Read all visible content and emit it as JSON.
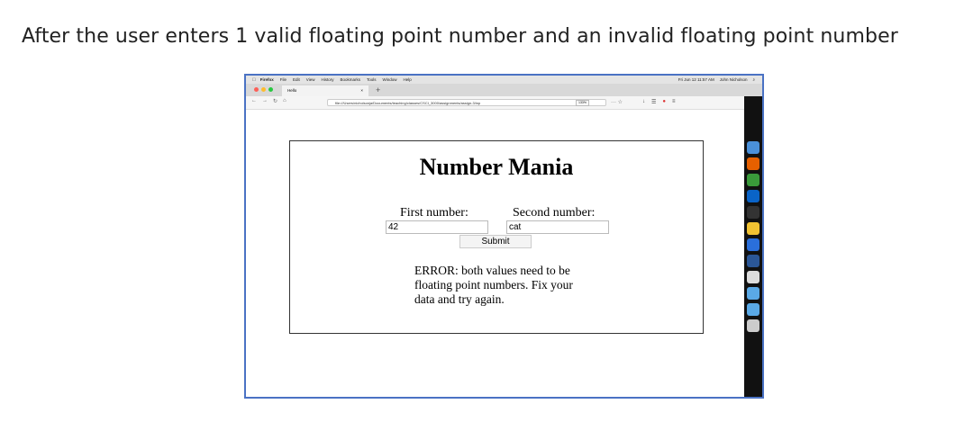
{
  "caption": "After the user enters 1 valid floating point number and an invalid floating point number",
  "menubar": {
    "app": "Firefox",
    "items": [
      "File",
      "Edit",
      "View",
      "History",
      "Bookmarks",
      "Tools",
      "Window",
      "Help"
    ],
    "clock": "Fri Jun 12  11:57 AM",
    "user": "John Nicholson"
  },
  "tab": {
    "title": "Hello",
    "close": "×",
    "new_tab": "+"
  },
  "url": {
    "value": "file:///Users/nicholsonja/Documents/teaching/classes/CSCI_3000/assignments/assign-3/inp",
    "zoom": "133%"
  },
  "page": {
    "heading": "Number Mania",
    "first_label": "First number:",
    "second_label": "Second number:",
    "first_value": "42",
    "second_value": "cat",
    "submit_label": "Submit",
    "error_text": "ERROR: both values need to be floating point numbers. Fix your data and try again."
  },
  "colors": {
    "frame_border": "#4a72c4",
    "dock_bg": "#111111"
  },
  "icons": [
    "apple-icon",
    "back-icon",
    "forward-icon",
    "reload-icon",
    "home-icon",
    "info-icon",
    "bookmark-star-icon",
    "download-icon",
    "library-icon",
    "menu-icon"
  ]
}
